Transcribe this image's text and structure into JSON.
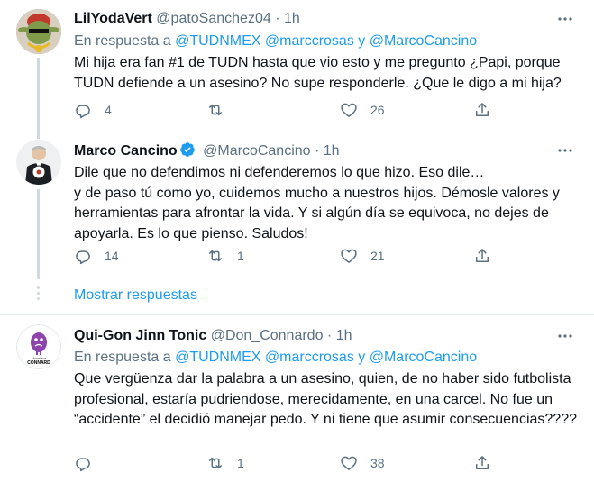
{
  "tweets": [
    {
      "name": "LilYodaVert",
      "handle": "@patoSanchez04",
      "dot": "·",
      "time": "1h",
      "reply_prefix": "En respuesta a",
      "reply_to_1": "@TUDNMEX",
      "reply_to_2": "@marccrosas",
      "reply_and": "y",
      "reply_to_3": "@MarcoCancino",
      "text": "Mi hija era fan #1 de TUDN hasta que vio esto y me pregunto ¿Papi, porque TUDN defiende a un asesino? No supe responderle. ¿Que le digo a mi hija?",
      "replies": "4",
      "retweets": "",
      "likes": "26"
    },
    {
      "name": "Marco Cancino",
      "handle": "@MarcoCancino",
      "dot": "·",
      "time": "1h",
      "text": "Dile que no defendimos ni defenderemos lo que hizo. Eso dile…\ny de paso tú como yo, cuidemos mucho a nuestros hijos. Démosle valores y herramientas para afrontar la vida. Y si algún día se equivoca, no dejes de apoyarla. Es lo que pienso. Saludos!",
      "replies": "14",
      "retweets": "1",
      "likes": "21"
    },
    {
      "name": "Qui-Gon Jinn Tonic",
      "handle": "@Don_Connardo",
      "dot": "·",
      "time": "1h",
      "reply_prefix": "En respuesta a",
      "reply_to_1": "@TUDNMEX",
      "reply_to_2": "@marccrosas",
      "reply_and": "y",
      "reply_to_3": "@MarcoCancino",
      "text": "Que vergüenza dar la palabra a un asesino, quien, de no haber sido futbolista profesional, estaría pudriendose, merecidamente, en una carcel. No fue un “accidente” el decidió manejar pedo. Y ni tiene que asumir consecuencias????",
      "replies": "",
      "retweets": "1",
      "likes": "38"
    }
  ],
  "show_replies_label": "Mostrar respuestas",
  "avatar3_caption_1": "Monsieur",
  "avatar3_caption_2": "CONNARD",
  "colors": {
    "accent": "#1d9bf0",
    "secondary_text": "#5b7083",
    "thread_line": "#cfd9de"
  }
}
